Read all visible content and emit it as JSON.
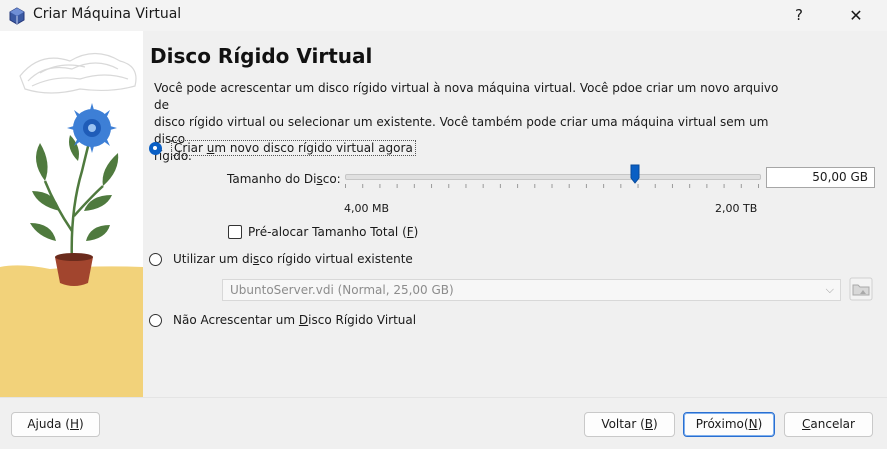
{
  "window": {
    "title": "Criar Máquina Virtual",
    "help_label": "?",
    "close_label": "✕"
  },
  "page": {
    "heading": "Disco Rígido Virtual",
    "description_lines": [
      "Você pode acrescentar um disco rígido virtual à nova máquina virtual. Você pdoe criar um novo arquivo de",
      "disco rígido virtual ou selecionar um existente. Você também pode criar uma máquina virtual sem um disco",
      "rígido."
    ]
  },
  "options": {
    "create_new": {
      "label_pre": "Criar ",
      "label_accel": "u",
      "label_post": "m novo disco rígido virtual agora",
      "checked": true
    },
    "use_existing": {
      "label_pre": "Utilizar um di",
      "label_accel": "s",
      "label_post": "co rígido virtual existente",
      "checked": false
    },
    "no_disk": {
      "label_pre": "Não Acrescentar um ",
      "label_accel": "D",
      "label_post": "isco Rígido Virtual",
      "checked": false
    }
  },
  "disk_size": {
    "label_pre": "Tamanho do Di",
    "label_accel": "s",
    "label_post": "co:",
    "value": "50,00 GB",
    "min_label": "4,00 MB",
    "max_label": "2,00 TB",
    "slider_fraction": 0.7
  },
  "preallocate": {
    "label_pre": "Pré-alocar Tamanho Total (",
    "label_accel": "F",
    "label_post": ")",
    "checked": false
  },
  "existing_disk": {
    "selected": "UbuntoServer.vdi (Normal, 25,00 GB)"
  },
  "buttons": {
    "help": {
      "pre": "Ajuda (",
      "accel": "H",
      "post": ")"
    },
    "back": {
      "pre": "Voltar (",
      "accel": "B",
      "post": ")"
    },
    "next": {
      "pre": "Próximo(",
      "accel": "N",
      "post": ")"
    },
    "cancel": {
      "pre": "",
      "accel": "C",
      "post": "ancelar"
    }
  },
  "colors": {
    "accent": "#0a5fc4",
    "art_sky": "#ffffff",
    "art_ground": "#f2d27a",
    "flower": "#3d7fd6",
    "leaves": "#4f7a3e",
    "pot": "#a2452e"
  }
}
